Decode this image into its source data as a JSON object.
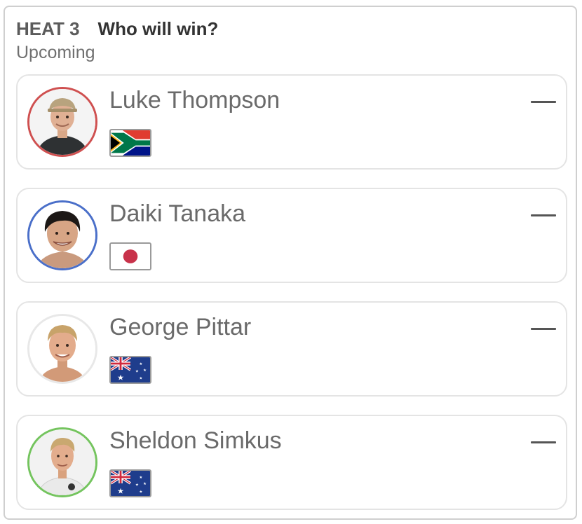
{
  "header": {
    "heat_label": "HEAT 3",
    "question": "Who will win?",
    "status": "Upcoming"
  },
  "surfers": [
    {
      "name": "Luke Thompson",
      "flag_icon": "south-africa-flag-icon",
      "ring_color": "#cf5050",
      "score": "—"
    },
    {
      "name": "Daiki Tanaka",
      "flag_icon": "japan-flag-icon",
      "ring_color": "#4a6fc9",
      "score": "—"
    },
    {
      "name": "George Pittar",
      "flag_icon": "australia-flag-icon",
      "ring_color": "#e8e8e8",
      "score": "—"
    },
    {
      "name": "Sheldon Simkus",
      "flag_icon": "australia-flag-icon",
      "ring_color": "#74c45e",
      "score": "—"
    }
  ]
}
